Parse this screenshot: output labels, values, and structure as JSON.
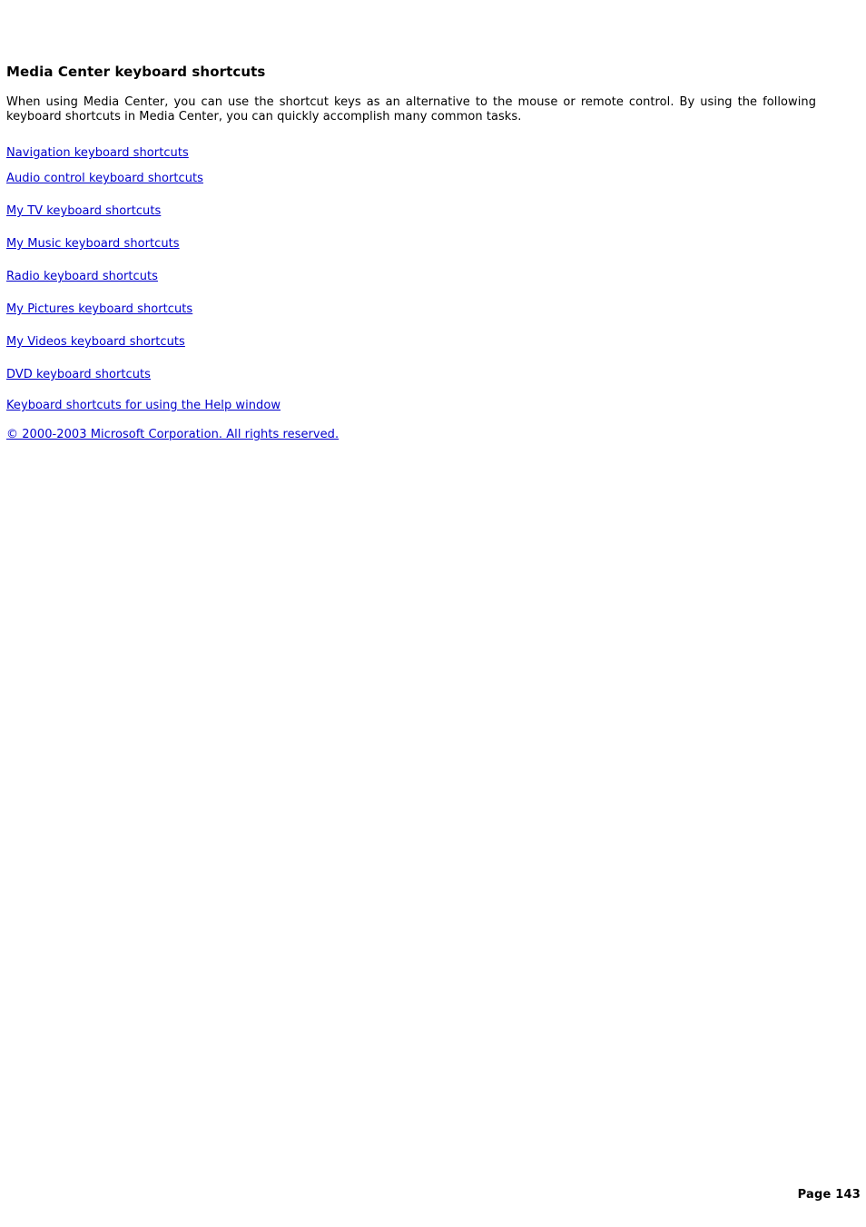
{
  "document": {
    "title": "Media Center keyboard shortcuts",
    "intro": "When using Media Center, you can use the shortcut keys as an alternative to the mouse or remote control. By using the following keyboard shortcuts in Media Center, you can quickly accomplish many common tasks.",
    "links": [
      {
        "label": "Navigation keyboard shortcuts"
      },
      {
        "label": "Audio control keyboard shortcuts"
      },
      {
        "label": "My TV keyboard shortcuts"
      },
      {
        "label": "My Music keyboard shortcuts"
      },
      {
        "label": "Radio keyboard shortcuts"
      },
      {
        "label": "My Pictures keyboard shortcuts"
      },
      {
        "label": "My Videos keyboard shortcuts"
      },
      {
        "label": "DVD keyboard shortcuts"
      },
      {
        "label": "Keyboard shortcuts for using the Help window"
      }
    ],
    "copyright": "© 2000-2003 Microsoft Corporation. All rights reserved."
  },
  "footer": {
    "page_label": "Page 143"
  },
  "colors": {
    "link": "#0000cc",
    "text": "#000000",
    "background": "#ffffff"
  }
}
